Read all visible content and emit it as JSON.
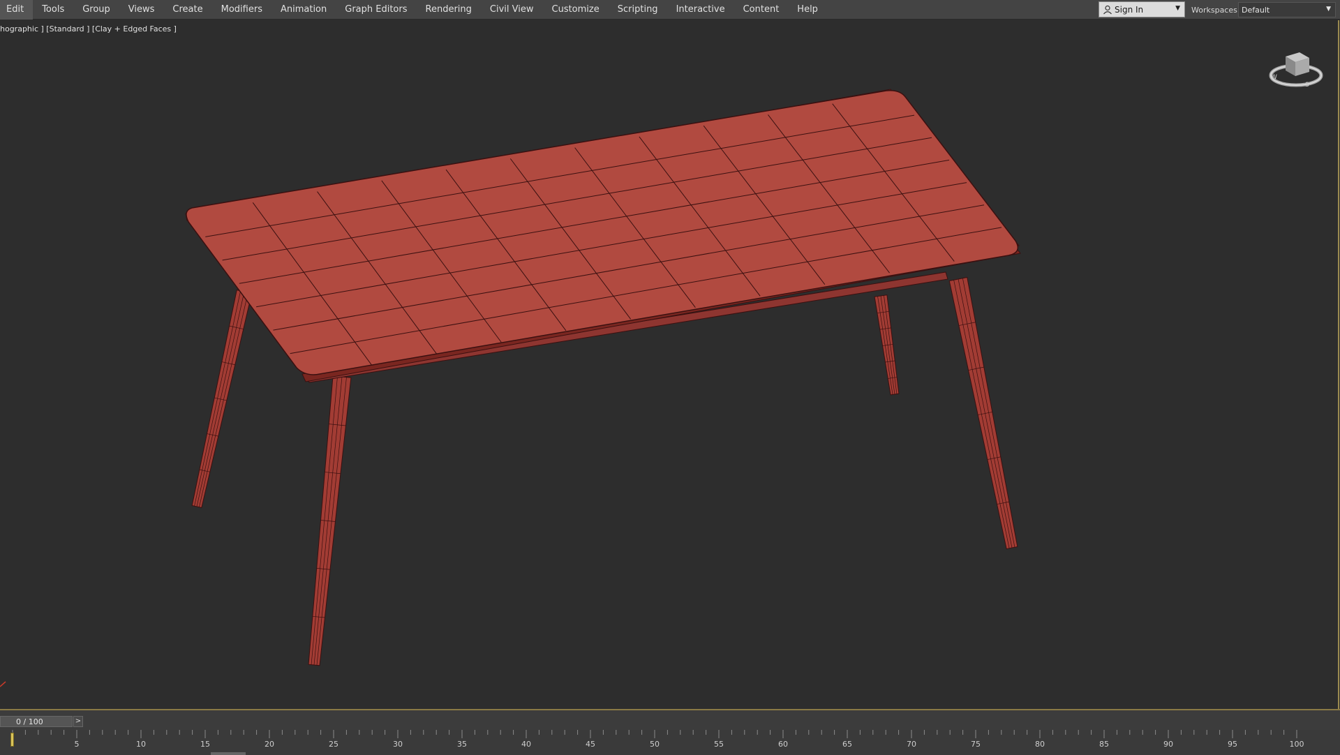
{
  "menu": {
    "items": [
      {
        "label": "Edit"
      },
      {
        "label": "Tools"
      },
      {
        "label": "Group"
      },
      {
        "label": "Views"
      },
      {
        "label": "Create"
      },
      {
        "label": "Modifiers"
      },
      {
        "label": "Animation"
      },
      {
        "label": "Graph Editors"
      },
      {
        "label": "Rendering"
      },
      {
        "label": "Civil View"
      },
      {
        "label": "Customize"
      },
      {
        "label": "Scripting"
      },
      {
        "label": "Interactive"
      },
      {
        "label": "Content"
      },
      {
        "label": "Help"
      }
    ]
  },
  "account": {
    "signin_label": "Sign In",
    "icon": "user-icon"
  },
  "workspaces": {
    "label": "Workspaces:",
    "value": "Default"
  },
  "viewport": {
    "label": "hographic ] [Standard ] [Clay + Edged Faces ]",
    "model_color": "#b14a40",
    "edge_color": "#3a1010",
    "background": "#2d2d2d"
  },
  "timeline": {
    "frame_display": "0 / 100",
    "next_label": ">",
    "current_frame": 0,
    "total_frames": 100,
    "tick_labels": [
      "5",
      "10",
      "15",
      "20",
      "25",
      "30",
      "35",
      "40",
      "45",
      "50",
      "55",
      "60",
      "65",
      "70",
      "75",
      "80",
      "85",
      "90",
      "95",
      "100"
    ]
  }
}
